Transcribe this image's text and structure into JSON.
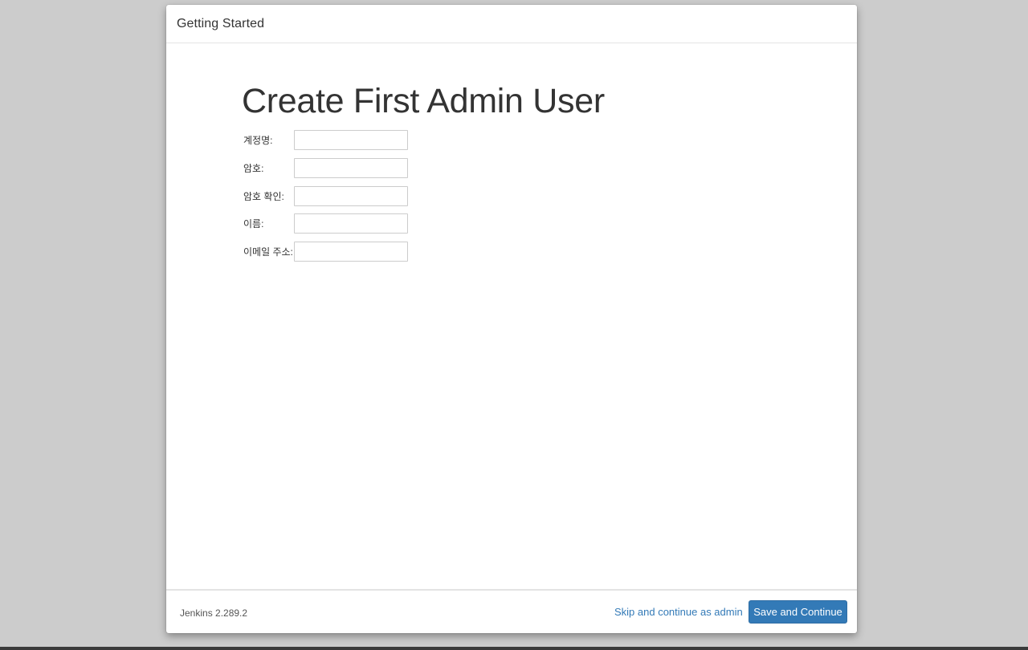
{
  "dialog": {
    "title": "Getting Started"
  },
  "page": {
    "heading": "Create First Admin User"
  },
  "form": {
    "fields": [
      {
        "label": "계정명:",
        "value": ""
      },
      {
        "label": "암호:",
        "value": ""
      },
      {
        "label": "암호 확인:",
        "value": ""
      },
      {
        "label": "이름:",
        "value": ""
      },
      {
        "label": "이메일 주소:",
        "value": ""
      }
    ]
  },
  "footer": {
    "version": "Jenkins 2.289.2",
    "skip_label": "Skip and continue as admin",
    "save_label": "Save and Continue"
  },
  "colors": {
    "primary": "#337ab7",
    "background": "#cccccc",
    "text": "#333333"
  }
}
